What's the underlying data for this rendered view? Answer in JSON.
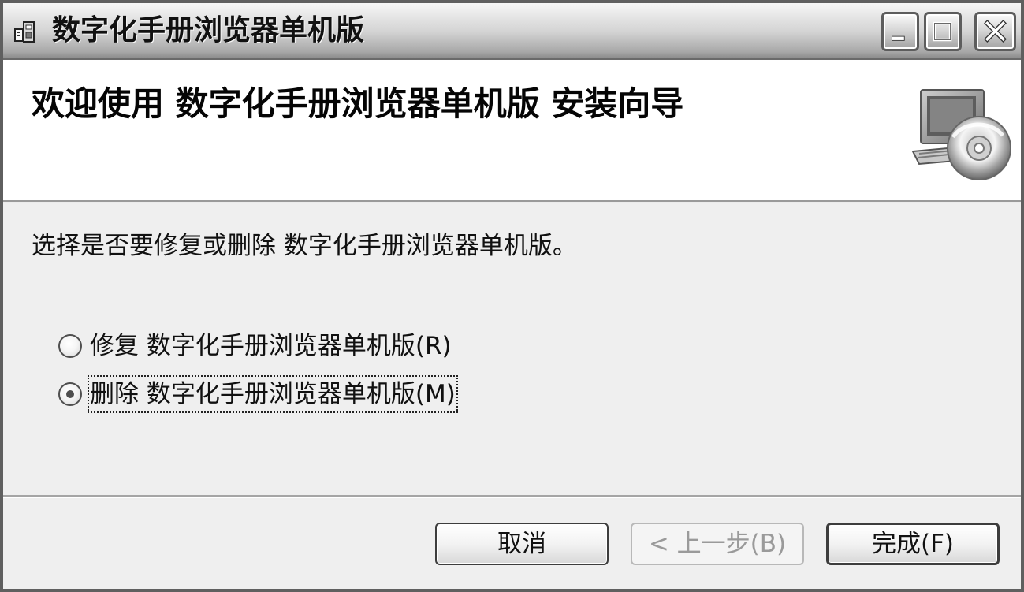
{
  "window": {
    "title": "数字化手册浏览器单机版",
    "icon": "installer-icon",
    "controls": {
      "minimize_icon": "minimize-icon",
      "maximize_icon": "maximize-icon",
      "close_icon": "close-icon"
    }
  },
  "banner": {
    "title": "欢迎使用 数字化手册浏览器单机版 安装向导",
    "artwork_icon": "computer-cd-icon"
  },
  "main": {
    "prompt": "选择是否要修复或删除 数字化手册浏览器单机版。",
    "options": [
      {
        "label": "修复 数字化手册浏览器单机版(R)",
        "selected": false
      },
      {
        "label": "删除 数字化手册浏览器单机版(M)",
        "selected": true
      }
    ]
  },
  "footer": {
    "cancel_label": "取消",
    "back_label": "< 上一步(B)",
    "finish_label": "完成(F)"
  },
  "colors": {
    "window_border": "#5f5f5f",
    "banner_background": "#ffffff",
    "content_background": "#efefef",
    "button_border": "#3d3d3d",
    "disabled_text": "#9a9a9a"
  }
}
